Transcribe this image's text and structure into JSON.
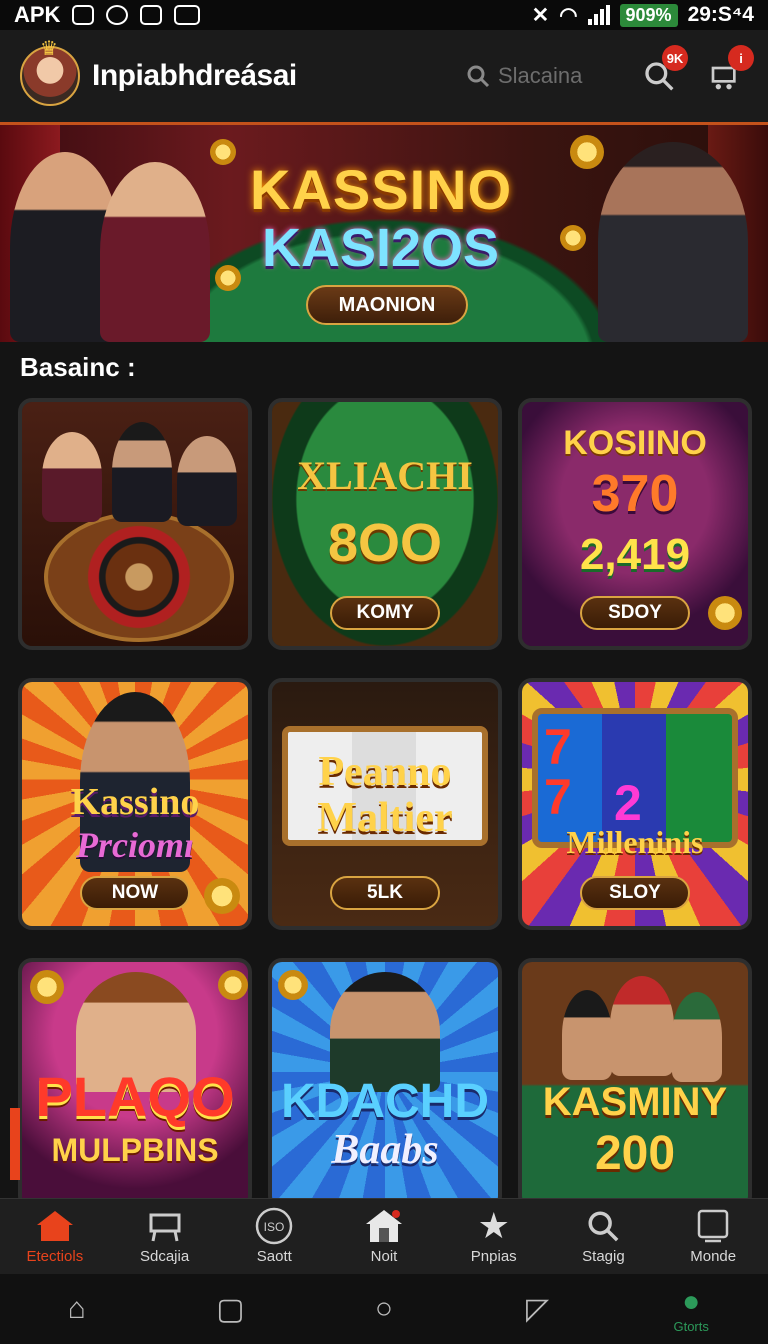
{
  "status_bar": {
    "app_label": "APK",
    "battery": "909%",
    "time": "29:S⁴4"
  },
  "header": {
    "title": "Inpiabhdreásai",
    "search_placeholder": "Slacaina",
    "notif_badge": "9K",
    "cart_badge": "i"
  },
  "banner": {
    "title_line1": "KASSINO",
    "title_line2": "KASI2OS",
    "button": "MAONION"
  },
  "section_title": "Basainc :",
  "games": [
    {
      "title": "",
      "subtitle": "",
      "button": "",
      "theme": "roulette"
    },
    {
      "title": "XLIACHI",
      "subtitle": "8OO",
      "button": "KOMY",
      "theme": "green"
    },
    {
      "title": "KOSIINO",
      "subtitle": "370",
      "subtitle2": "2,419",
      "button": "SDOY",
      "theme": "purple"
    },
    {
      "title": "Kassino",
      "subtitle": "Prciomı",
      "button": "NOW",
      "theme": "sunburst"
    },
    {
      "title": "Peanno",
      "subtitle": "Maltier",
      "button": "5LK",
      "theme": "slot"
    },
    {
      "title": "Milleninis",
      "subtitle": "",
      "button": "SLOY",
      "theme": "slots777"
    },
    {
      "title": "PLAQO",
      "subtitle": "MULPBINS",
      "button": "",
      "theme": "pink"
    },
    {
      "title": "KDACHD",
      "subtitle": "Baabs",
      "button": "",
      "theme": "blue"
    },
    {
      "title": "KASMINY",
      "subtitle": "200",
      "button": "",
      "theme": "bar"
    }
  ],
  "bottom_nav": [
    {
      "label": "Etectiols",
      "icon": "home-icon",
      "active": true
    },
    {
      "label": "Sdcajia",
      "icon": "cart-icon"
    },
    {
      "label": "Saott",
      "icon": "slot-icon"
    },
    {
      "label": "Noit",
      "icon": "house-icon"
    },
    {
      "label": "Pnpias",
      "icon": "star-icon"
    },
    {
      "label": "Stagig",
      "icon": "search-icon"
    },
    {
      "label": "Monde",
      "icon": "tablet-icon"
    }
  ],
  "system_nav": {
    "profile_label": "Gtorts"
  },
  "colors": {
    "accent": "#e8431c",
    "gold": "#d9a441",
    "background": "#141414"
  }
}
